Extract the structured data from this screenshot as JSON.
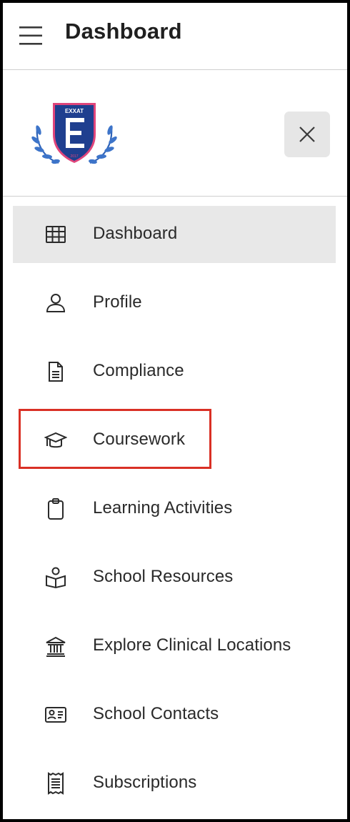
{
  "header": {
    "title": "Dashboard",
    "menu_icon": "hamburger-menu-icon"
  },
  "drawer": {
    "logo_text": "EXXAT",
    "logo_year": "2017",
    "close_icon": "close-icon"
  },
  "nav": {
    "items": [
      {
        "label": "Dashboard",
        "icon": "grid-icon",
        "active": true
      },
      {
        "label": "Profile",
        "icon": "person-icon",
        "active": false
      },
      {
        "label": "Compliance",
        "icon": "document-icon",
        "active": false
      },
      {
        "label": "Coursework",
        "icon": "graduation-cap-icon",
        "active": false,
        "highlighted": true
      },
      {
        "label": "Learning Activities",
        "icon": "clipboard-icon",
        "active": false
      },
      {
        "label": "School Resources",
        "icon": "reading-person-icon",
        "active": false
      },
      {
        "label": "Explore Clinical Locations",
        "icon": "institution-icon",
        "active": false
      },
      {
        "label": "School Contacts",
        "icon": "contact-card-icon",
        "active": false
      },
      {
        "label": "Subscriptions",
        "icon": "receipt-icon",
        "active": false
      }
    ]
  },
  "colors": {
    "active_bg": "#e8e8e8",
    "highlight_border": "#d93025",
    "close_button_bg": "#e6e6e6",
    "logo_shield": "#1f3f8f",
    "logo_border": "#e0457b"
  }
}
